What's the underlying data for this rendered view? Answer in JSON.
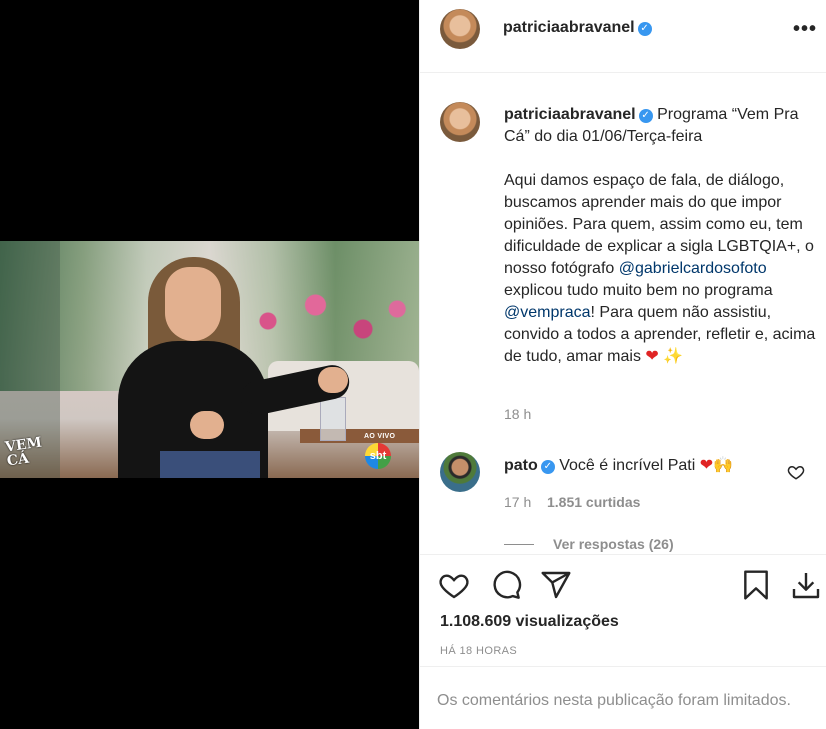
{
  "post": {
    "author": "patriciaabravanel",
    "more_icon": "•••",
    "caption_head": "Programa “Vem Pra Cá” do dia 01/06/Terça-feira",
    "caption_parts": {
      "p1": "Aqui damos espaço de fala, de diálogo, buscamos aprender mais do que impor opiniões. Para quem, assim como eu, tem dificuldade de explicar a sigla LGBTQIA+, o nosso fotógrafo ",
      "mention1": "@gabrielcardosofoto",
      "p2": " explicou tudo muito bem no programa ",
      "mention2": "@vempraca",
      "p3": "! Para quem não assistiu, convido a todos a aprender, refletir e, acima de tudo, amar mais ",
      "emoji1": "❤",
      "emoji2": "✨"
    },
    "caption_time": "18 h"
  },
  "comment": {
    "user": "pato",
    "text": "Você é incrível Pati",
    "emoji1": "❤",
    "emoji2": "🙌",
    "time": "17 h",
    "likes": "1.851 curtidas",
    "replies": "Ver respostas (26)"
  },
  "video": {
    "logo_text": "VEM CÁ",
    "live_label": "AO VIVO",
    "network": "sbt"
  },
  "stats": {
    "views": "1.108.609 visualizações",
    "posted_ago": "HÁ 18 HORAS"
  },
  "footer": {
    "limited": "Os comentários nesta publicação foram limitados."
  },
  "icons": {
    "verified": "✓"
  }
}
